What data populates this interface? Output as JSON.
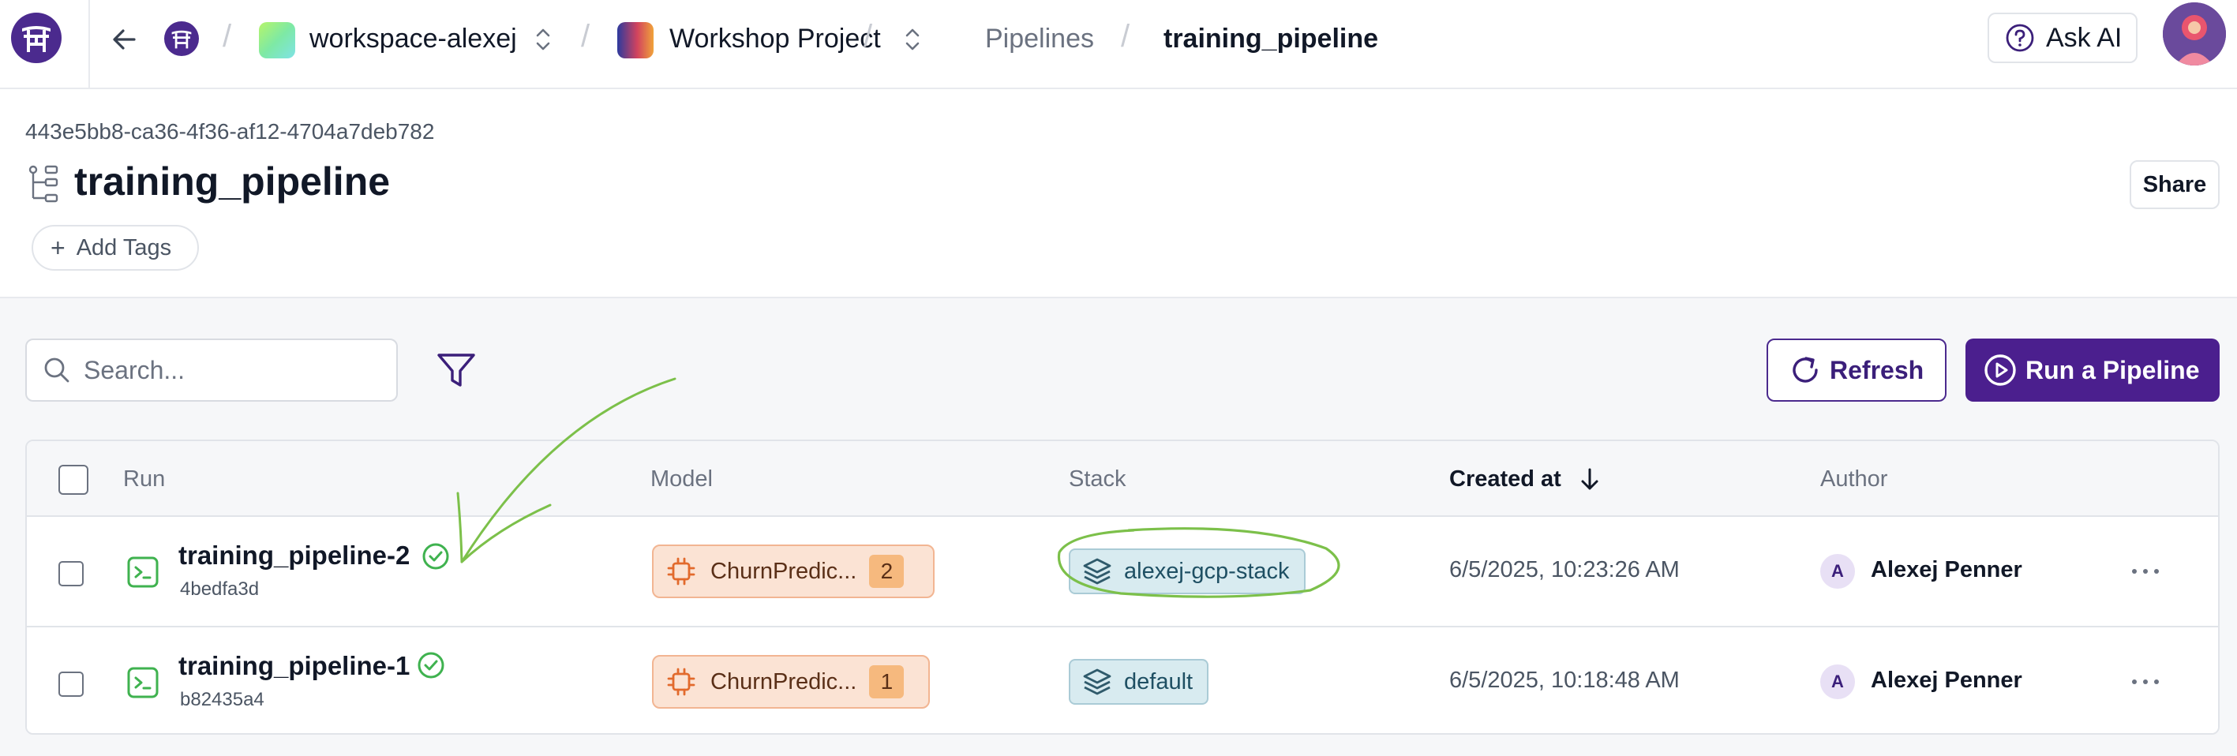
{
  "topbar": {
    "workspace_name": "workspace-alexej",
    "project_name": "Workshop Project",
    "crumb_pipelines": "Pipelines",
    "crumb_current": "training_pipeline",
    "ask_ai_label": "Ask AI"
  },
  "header": {
    "pipeline_id": "443e5bb8-ca36-4f36-af12-4704a7deb782",
    "title": "training_pipeline",
    "add_tags_label": "Add Tags",
    "share_label": "Share"
  },
  "toolbar": {
    "search_placeholder": "Search...",
    "refresh_label": "Refresh",
    "run_label": "Run a Pipeline"
  },
  "table": {
    "columns": [
      "Run",
      "Model",
      "Stack",
      "Created at",
      "Author"
    ],
    "sorted_column": "Created at",
    "sort_direction": "descending",
    "rows": [
      {
        "run_name": "training_pipeline-2",
        "run_hash": "4bedfa3d",
        "status": "completed",
        "model_name": "ChurnPredic...",
        "model_version": "2",
        "stack": "alexej-gcp-stack",
        "created_at": "6/5/2025, 10:23:26 AM",
        "author_initial": "A",
        "author_name": "Alexej Penner"
      },
      {
        "run_name": "training_pipeline-1",
        "run_hash": "b82435a4",
        "status": "completed",
        "model_name": "ChurnPredic...",
        "model_version": "1",
        "stack": "default",
        "created_at": "6/5/2025, 10:18:48 AM",
        "author_initial": "A",
        "author_name": "Alexej Penner"
      }
    ]
  },
  "colors": {
    "brand": "#4b1f8e",
    "success": "#3fb24f",
    "annotation": "#7cc04a"
  },
  "icons": [
    "app-logo-icon",
    "back-arrow-icon",
    "updown-chevron-icon",
    "help-circle-icon",
    "pipeline-icon",
    "plus-icon",
    "search-icon",
    "filter-icon",
    "refresh-icon",
    "play-circle-icon",
    "terminal-icon",
    "check-circle-icon",
    "chip-icon",
    "layers-icon",
    "sort-down-icon",
    "more-horizontal-icon"
  ]
}
